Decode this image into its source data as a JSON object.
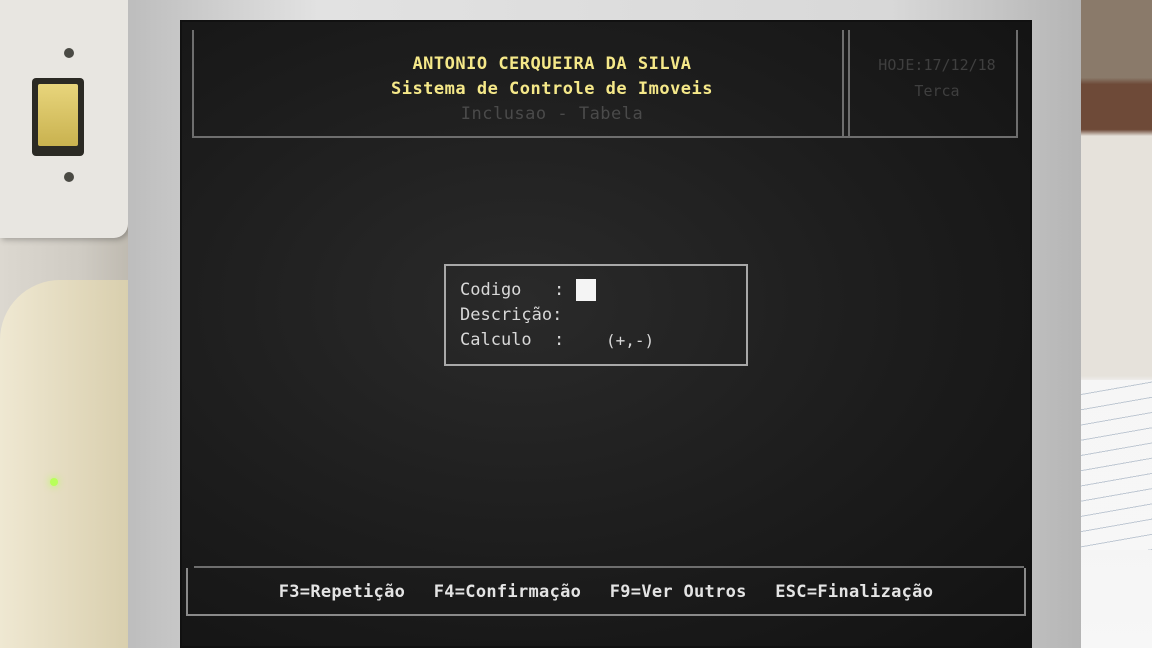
{
  "header": {
    "owner_name": "ANTONIO CERQUEIRA DA SILVA",
    "system_title": "Sistema de Controle de Imoveis",
    "screen_mode": "Inclusao - Tabela",
    "date": "HOJE:17/12/18",
    "weekday": "Terca"
  },
  "form": {
    "codigo_label": "Codigo",
    "descricao_label": "Descrição:",
    "calculo_label": "Calculo",
    "colon": ":",
    "calculo_hint": "(+,-)",
    "codigo_value": "",
    "descricao_value": "",
    "calculo_value": ""
  },
  "footer": {
    "f3": "F3=Repetição",
    "f4": "F4=Confirmação",
    "f9": "F9=Ver Outros",
    "esc": "ESC=Finalização"
  },
  "colors": {
    "title_yellow": "#f5e889",
    "screen_bg": "#1c1c1c",
    "text_gray": "#d8d8d8"
  }
}
